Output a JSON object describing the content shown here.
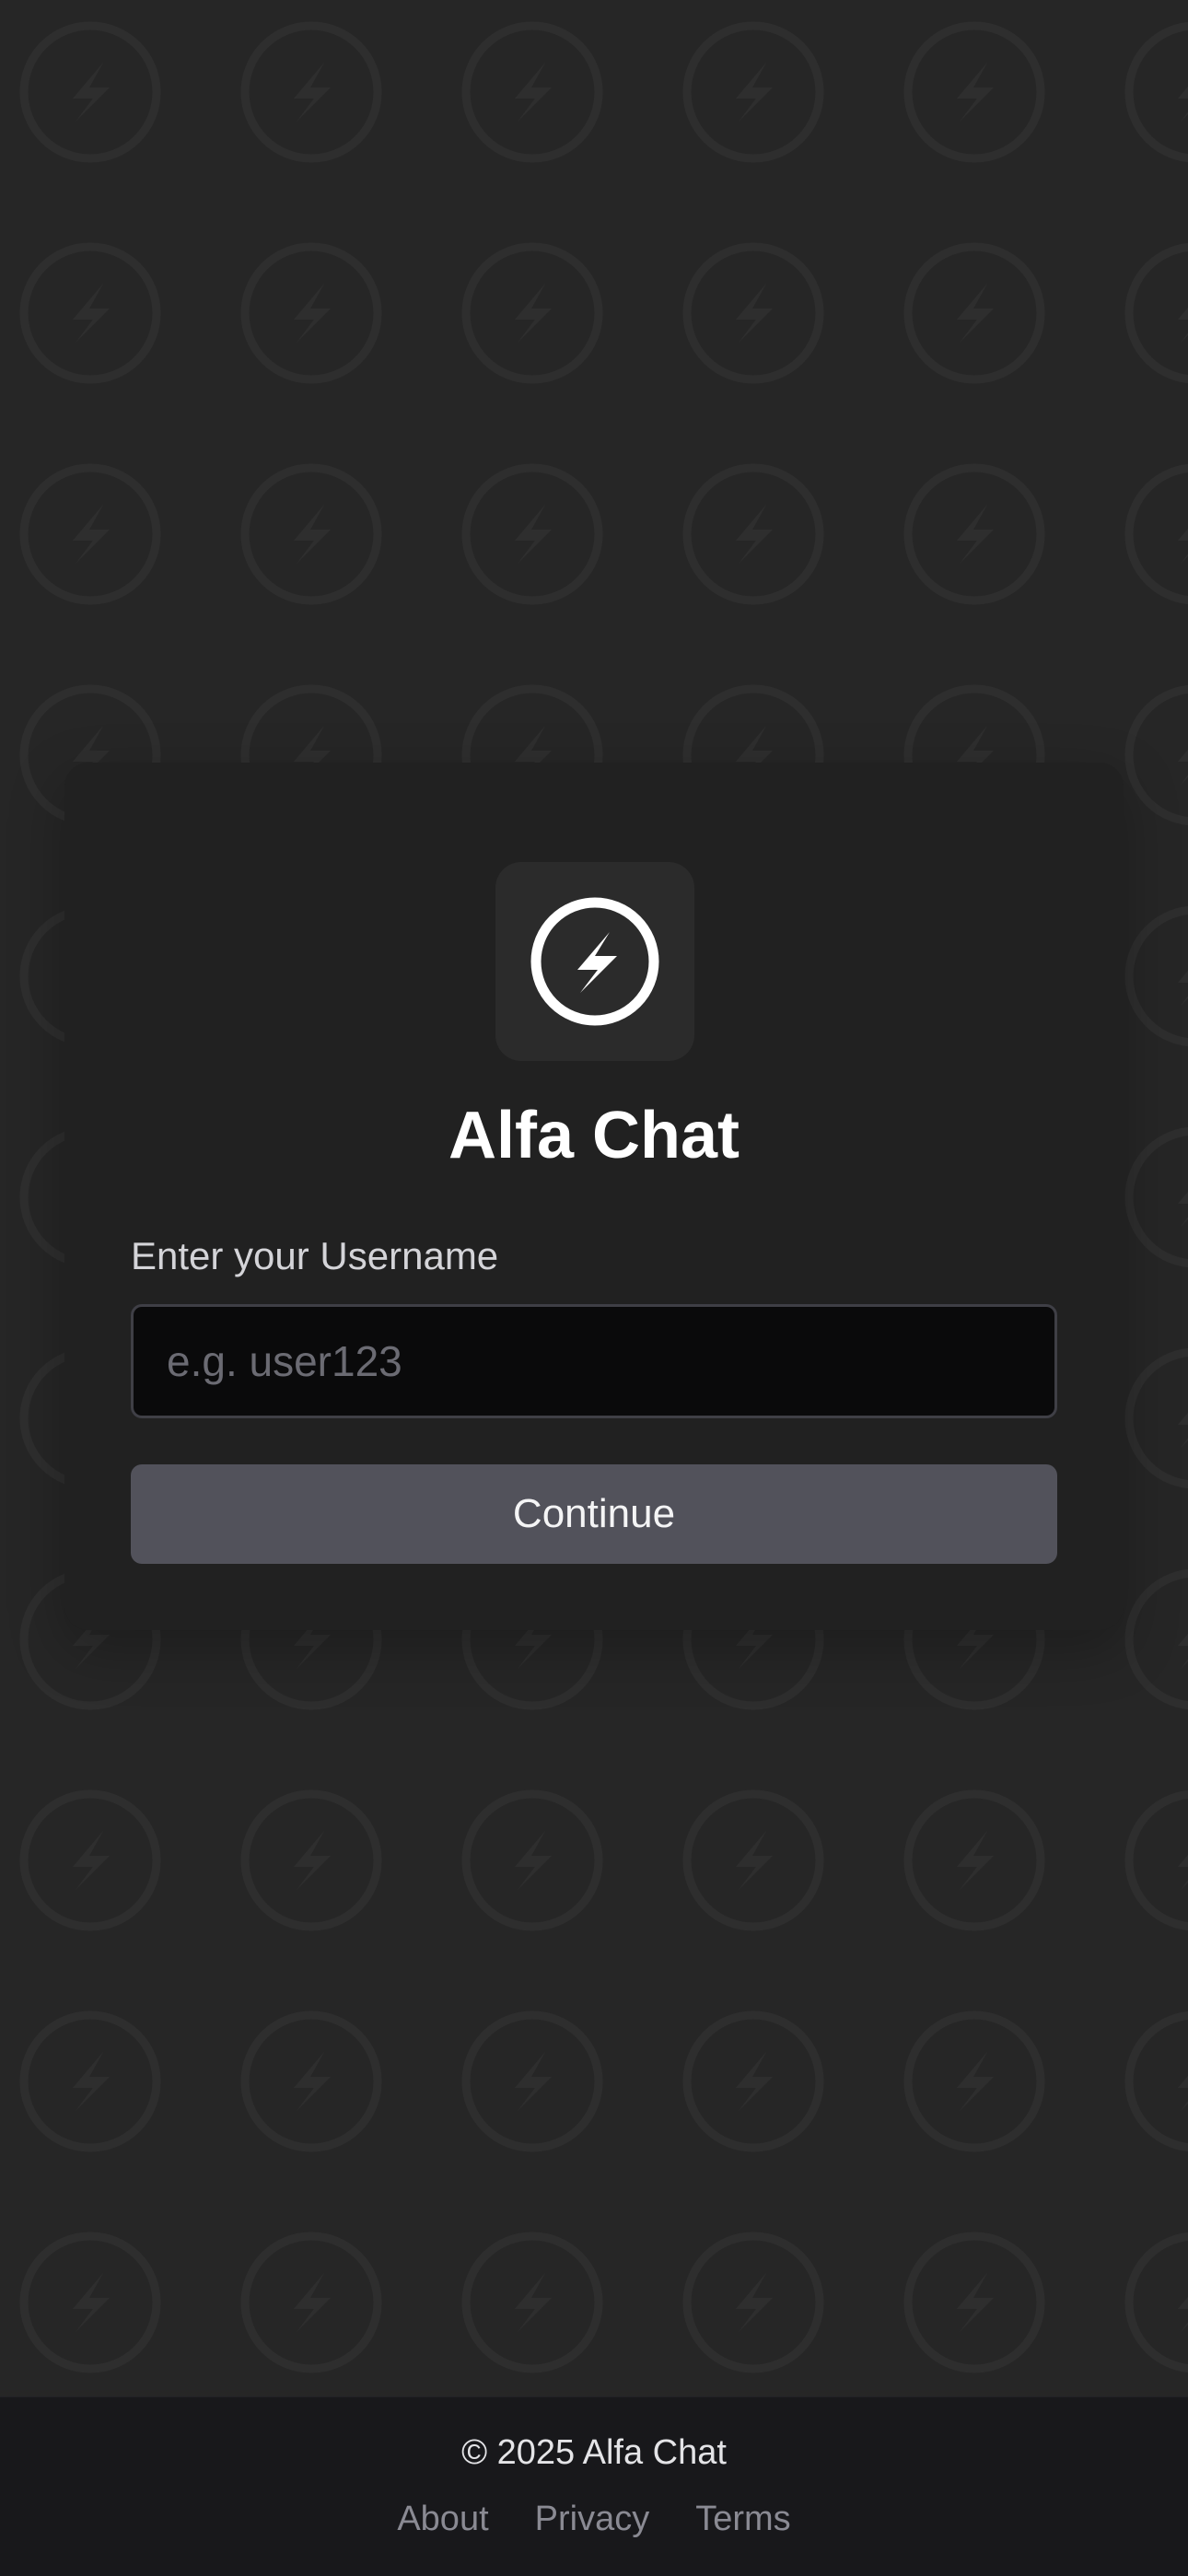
{
  "app": {
    "name": "Alfa Chat",
    "background_color": "#262626",
    "accent_color": "#52525b"
  },
  "login": {
    "logo_icon": "bolt-circle-icon",
    "title": "Alfa Chat",
    "username_label": "Enter your Username",
    "username_placeholder": "e.g. user123",
    "username_value": "",
    "continue_label": "Continue"
  },
  "footer": {
    "copyright": "© 2025 Alfa Chat",
    "links": [
      {
        "label": "About"
      },
      {
        "label": "Privacy"
      },
      {
        "label": "Terms"
      }
    ]
  }
}
